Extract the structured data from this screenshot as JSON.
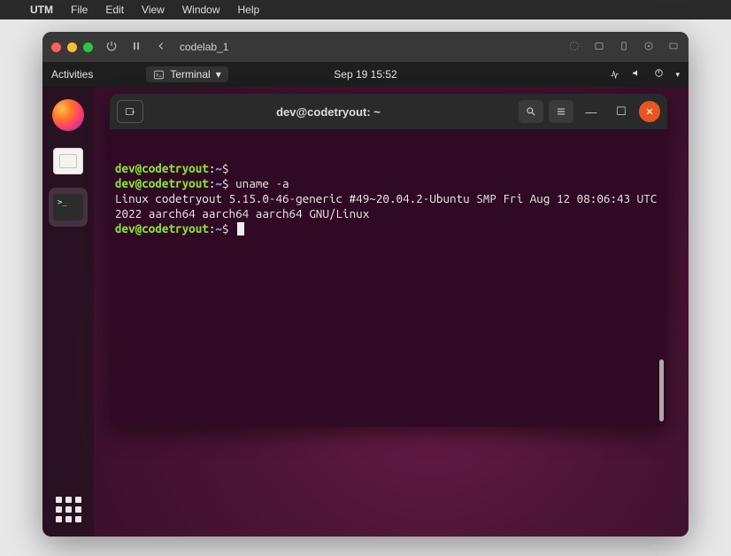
{
  "mac_menubar": {
    "items": [
      "UTM",
      "File",
      "Edit",
      "View",
      "Window",
      "Help"
    ]
  },
  "utm": {
    "title": "codelab_1"
  },
  "gnome": {
    "activities": "Activities",
    "term_menu_label": "Terminal",
    "clock": "Sep 19  15:52"
  },
  "terminal": {
    "title": "dev@codetryout: ~",
    "lines": [
      {
        "type": "prompt",
        "user": "dev@codetryout",
        "path": "~",
        "cmd": ""
      },
      {
        "type": "prompt",
        "user": "dev@codetryout",
        "path": "~",
        "cmd": "uname -a"
      },
      {
        "type": "output",
        "text": "Linux codetryout 5.15.0-46-generic #49~20.04.2-Ubuntu SMP Fri Aug 12 08:06:43 UTC 2022 aarch64 aarch64 aarch64 GNU/Linux"
      },
      {
        "type": "prompt",
        "user": "dev@codetryout",
        "path": "~",
        "cmd": "",
        "cursor": true
      }
    ]
  }
}
